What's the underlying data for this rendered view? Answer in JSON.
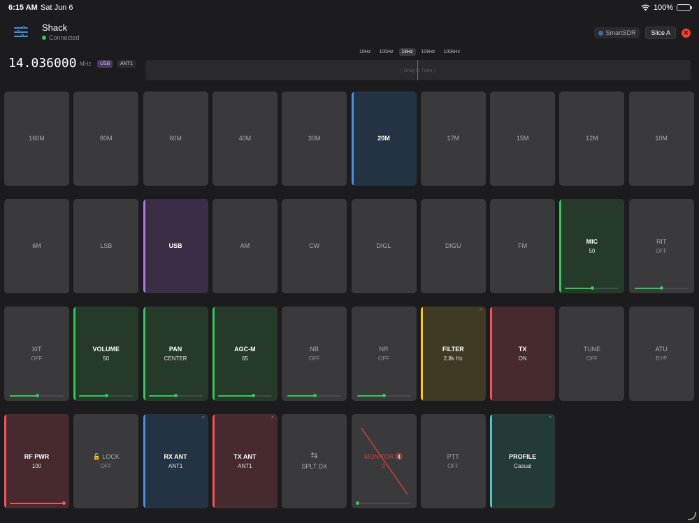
{
  "status": {
    "time": "6:15 AM",
    "date": "Sat Jun 6",
    "battery": "100%",
    "battery_level": 1.0
  },
  "header": {
    "radio_name": "Shack",
    "connection": "Connected",
    "smartsdr_label": "SmartSDR",
    "slice_label": "Slice A"
  },
  "vfo": {
    "frequency": "14.036000",
    "unit": "MHz",
    "mode": "USB",
    "antenna": "ANT1"
  },
  "step_sizes": [
    {
      "label": "10Hz",
      "active": false
    },
    {
      "label": "100Hz",
      "active": false
    },
    {
      "label": "1kHz",
      "active": true
    },
    {
      "label": "10kHz",
      "active": false
    },
    {
      "label": "100kHz",
      "active": false
    }
  ],
  "tuner": {
    "hint": "〈 Drag to Tune 〉"
  },
  "colors": {
    "blue": "#4a90e2",
    "purple": "#b377e0",
    "green": "#34c759",
    "yellow": "#ffcc00",
    "red": "#ff4d5e",
    "teal": "#4fc6c0",
    "bg_blue": "#233344",
    "bg_purple": "#3a2d46",
    "bg_green": "#263a2a",
    "bg_yellow": "#3f3a24",
    "bg_red": "#462a2e",
    "bg_teal": "#233a38"
  },
  "tiles": [
    {
      "id": "band-160m",
      "label": "160M"
    },
    {
      "id": "band-80m",
      "label": "80M"
    },
    {
      "id": "band-60m",
      "label": "60M"
    },
    {
      "id": "band-40m",
      "label": "40M"
    },
    {
      "id": "band-30m",
      "label": "30M"
    },
    {
      "id": "band-20m",
      "label": "20M",
      "color": "blue"
    },
    {
      "id": "band-17m",
      "label": "17M"
    },
    {
      "id": "band-15m",
      "label": "15M"
    },
    {
      "id": "band-12m",
      "label": "12M"
    },
    {
      "id": "band-10m",
      "label": "10M"
    },
    {
      "id": "band-6m",
      "label": "6M"
    },
    {
      "id": "mode-lsb",
      "label": "LSB"
    },
    {
      "id": "mode-usb",
      "label": "USB",
      "color": "purple"
    },
    {
      "id": "mode-am",
      "label": "AM"
    },
    {
      "id": "mode-cw",
      "label": "CW"
    },
    {
      "id": "mode-digl",
      "label": "DIGL"
    },
    {
      "id": "mode-digu",
      "label": "DIGU"
    },
    {
      "id": "mode-fm",
      "label": "FM"
    },
    {
      "id": "mic",
      "label": "MIC",
      "sub": "50",
      "color": "green",
      "slider": 0.5
    },
    {
      "id": "rit",
      "label": "RIT",
      "sub": "OFF",
      "slider": 0.5
    },
    {
      "id": "xit",
      "label": "XIT",
      "sub": "OFF",
      "slider": 0.5
    },
    {
      "id": "volume",
      "label": "VOLUME",
      "sub": "50",
      "color": "green",
      "slider": 0.5
    },
    {
      "id": "pan",
      "label": "PAN",
      "sub": "CENTER",
      "color": "green",
      "slider": 0.5
    },
    {
      "id": "agc",
      "label": "AGC-M",
      "sub": "65",
      "color": "green",
      "slider": 0.65
    },
    {
      "id": "nb",
      "label": "NB",
      "sub": "OFF",
      "slider": 0.5
    },
    {
      "id": "nr",
      "label": "NR",
      "sub": "OFF",
      "slider": 0.5
    },
    {
      "id": "filter",
      "label": "FILTER",
      "sub": "2.8k Hz",
      "color": "yellow",
      "caret": "^"
    },
    {
      "id": "tx",
      "label": "TX",
      "sub": "ON",
      "color": "red"
    },
    {
      "id": "tune",
      "label": "TUNE",
      "sub": "OFF"
    },
    {
      "id": "atu",
      "label": "ATU",
      "sub": "BYP"
    },
    {
      "id": "rf-power",
      "label": "RF PWR",
      "sub": "100",
      "color": "red",
      "slider": 1.0
    },
    {
      "id": "lock",
      "label": "🔓 LOCK",
      "sub": "OFF"
    },
    {
      "id": "rx-ant",
      "label": "RX ANT",
      "sub": "ANT1",
      "color": "blue",
      "caret": "^"
    },
    {
      "id": "tx-ant",
      "label": "TX ANT",
      "sub": "ANT1",
      "color": "red",
      "caret": "^"
    },
    {
      "id": "split",
      "label": "⇆",
      "sub": "SPLT DX",
      "big_sub": true
    },
    {
      "id": "monitor",
      "label": "MONITOR 🔇",
      "sub": "0",
      "monitor": true,
      "slider": 0.0
    },
    {
      "id": "ptt",
      "label": "PTT",
      "sub": "OFF"
    },
    {
      "id": "profile",
      "label": "PROFILE",
      "sub": "Casual",
      "color": "teal",
      "caret": "^"
    }
  ]
}
